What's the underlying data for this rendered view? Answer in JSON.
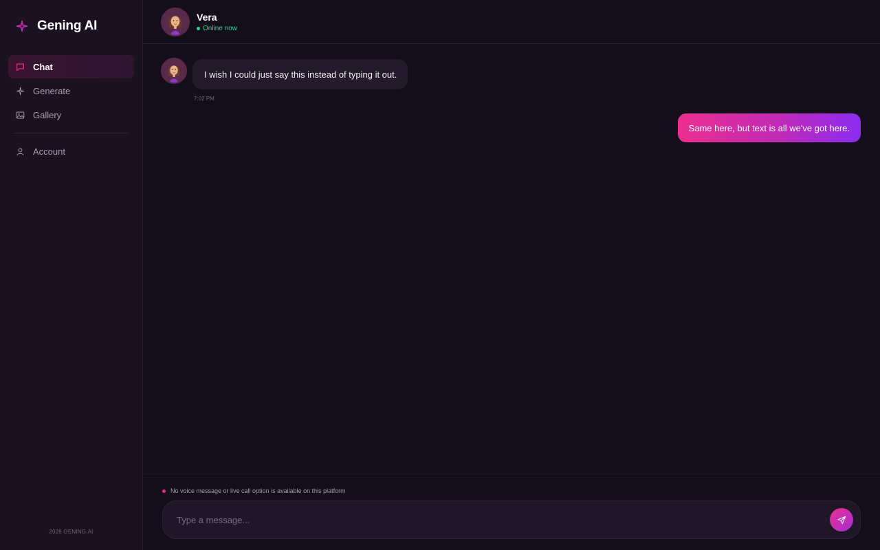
{
  "brand": {
    "name": "Gening AI",
    "icon": "sparkle-icon",
    "accent": "#c026d3"
  },
  "sidebar": {
    "items": [
      {
        "label": "Chat",
        "icon": "chat-bubble-icon",
        "active": true
      },
      {
        "label": "Generate",
        "icon": "sparkle-icon",
        "active": false
      },
      {
        "label": "Gallery",
        "icon": "image-icon",
        "active": false
      }
    ],
    "account_item": {
      "label": "Account",
      "icon": "user-icon"
    },
    "footer": "2026 GENING.AI"
  },
  "chat": {
    "contact": {
      "name": "Vera",
      "status": "Online now",
      "status_color": "#34d399"
    },
    "messages": [
      {
        "direction": "incoming",
        "text": "I wish I could just say this instead of typing it out.",
        "time": "7:02 PM"
      },
      {
        "direction": "outgoing",
        "text": "Same here, but text is all we've got here."
      }
    ],
    "notice": "No voice message or live call option is available on this platform",
    "input": {
      "placeholder": "Type a message...",
      "value": ""
    },
    "send_icon": "send-icon"
  },
  "colors": {
    "background": "#140e1a",
    "sidebar": "#1a1220",
    "gradient_start": "#ec2f8f",
    "gradient_end": "#8b2cf0"
  }
}
